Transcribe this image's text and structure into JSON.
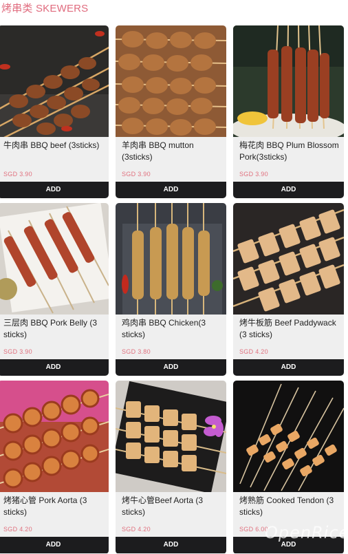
{
  "section": {
    "title": "烤串类 SKEWERS"
  },
  "add_label": "ADD",
  "items": [
    {
      "name": "牛肉串 BBQ beef (3sticks)",
      "price": "SGD 3.90",
      "image": "beef-skewers"
    },
    {
      "name": "羊肉串 BBQ mutton (3sticks)",
      "price": "SGD 3.90",
      "image": "mutton-skewers"
    },
    {
      "name": "梅花肉 BBQ Plum Blossom Pork(3sticks)",
      "price": "SGD 3.90",
      "image": "plum-blossom-pork-skewers"
    },
    {
      "name": "三层肉 BBQ Pork Belly (3 sticks)",
      "price": "SGD 3.90",
      "image": "pork-belly-skewers"
    },
    {
      "name": "鸡肉串 BBQ Chicken(3 sticks)",
      "price": "SGD 3.80",
      "image": "chicken-skewers"
    },
    {
      "name": "烤牛板筋 Beef Paddywack (3 sticks)",
      "price": "SGD 4.20",
      "image": "beef-paddywack-skewers"
    },
    {
      "name": "烤猪心管 Pork Aorta (3 sticks)",
      "price": "SGD 4.20",
      "image": "pork-aorta-skewers"
    },
    {
      "name": "烤牛心管Beef Aorta (3 sticks)",
      "price": "SGD 4.20",
      "image": "beef-aorta-skewers"
    },
    {
      "name": "烤熟筋 Cooked Tendon (3 sticks)",
      "price": "SGD 6.00",
      "image": "cooked-tendon-skewers"
    }
  ],
  "watermark": "OpenRice"
}
